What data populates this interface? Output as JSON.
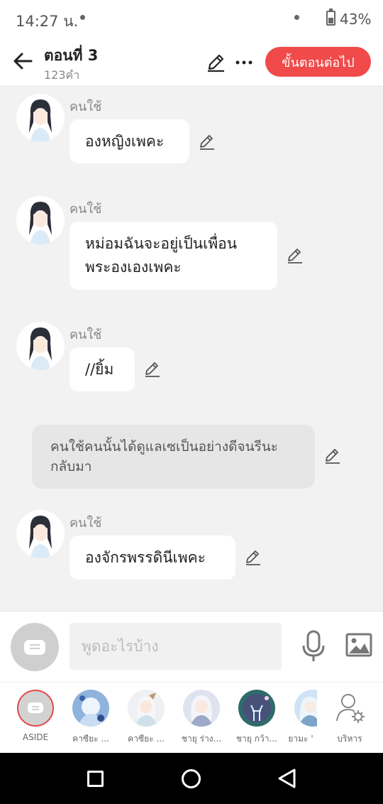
{
  "status": {
    "time": "14:27 น.",
    "battery": "43%"
  },
  "header": {
    "title": "ตอนที่ 3",
    "subtitle": "123คำ",
    "next_label": "ขั้นตอนต่อไป",
    "icons": [
      "back-arrow-icon",
      "edit-icon",
      "more-icon"
    ]
  },
  "messages": [
    {
      "speaker": "คนใช้",
      "text": "องหญิงเพคะ"
    },
    {
      "speaker": "คนใช้",
      "text": "หม่อมฉันจะอยู่เป็นเพื่อน\nพระองเองเพคะ"
    },
    {
      "speaker": "คนใช้",
      "text": "//ยิ้ม"
    },
    {
      "narration": "คนใช้คนนั้นได้ดูแลเซเป็นอย่างดีจนรีนะ\nกลับมา"
    },
    {
      "speaker": "คนใช้",
      "text": "องจักรพรรดินีเพคะ"
    }
  ],
  "input": {
    "placeholder": "พูดอะไรบ้าง",
    "icons": [
      "chat-bubble-icon",
      "microphone-icon",
      "image-icon"
    ]
  },
  "characters": [
    {
      "label": "ASIDE"
    },
    {
      "label": "คาซียะ ..."
    },
    {
      "label": "คาซียะ ..."
    },
    {
      "label": "ชายุ ร่าง..."
    },
    {
      "label": "ชายุ กว้า..."
    },
    {
      "label": "ยามะ ' "
    },
    {
      "label": "บริหาร"
    }
  ],
  "colors": {
    "accent": "#f04a4a",
    "background": "#f2f2f2"
  }
}
